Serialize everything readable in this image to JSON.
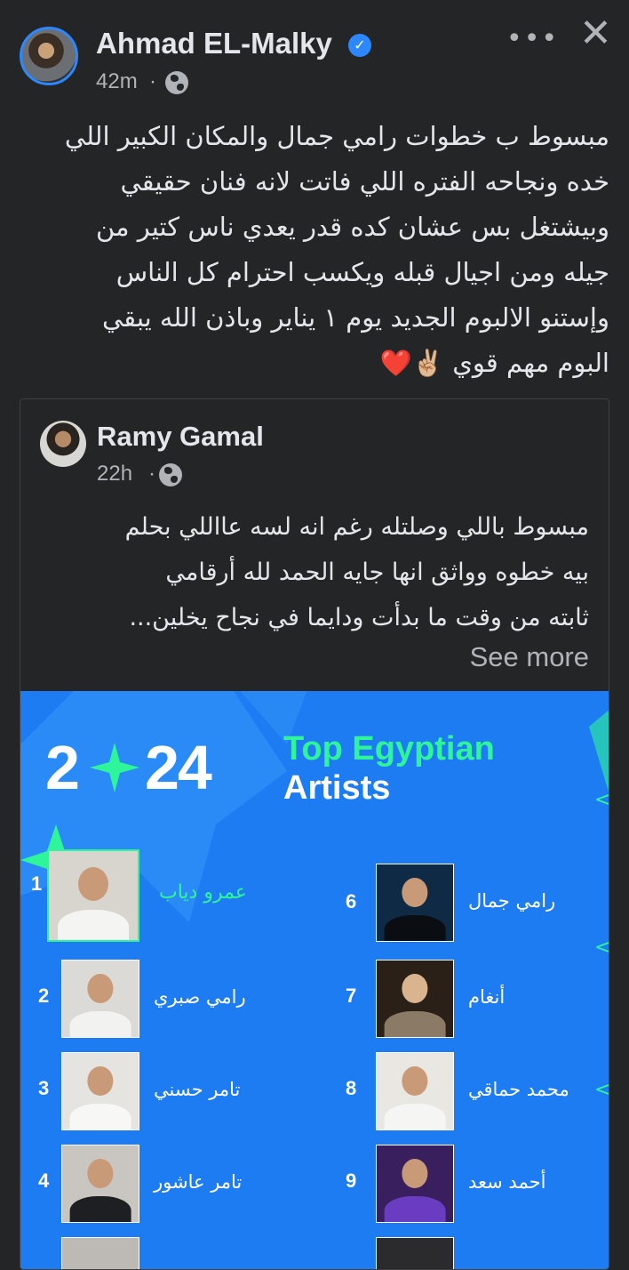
{
  "post": {
    "author": "Ahmad EL-Malky",
    "time": "42m",
    "privacy_icon": "globe-icon",
    "text_lines": [
      "مبسوط ب خطوات رامي جمال والمكان الكبير اللي",
      "خده ونجاحه الفتره اللي فاتت لانه فنان حقيقي",
      "وبيشتغل بس  عشان كده قدر يعدي ناس كتير من",
      "جيله ومن اجيال قبله ويكسب احترام كل الناس",
      "وإستنو الالبوم الجديد يوم ١ يناير   وباذن الله يبقي",
      "البوم مهم قوي ✌🏼❤️"
    ]
  },
  "shared": {
    "author": "Ramy Gamal",
    "time": "22h",
    "text_lines": [
      "مبسوط باللي وصلتله رغم انه لسه عااللي بحلم",
      "بيه خطوه وواثق انها جايه الحمد لله أرقامي",
      "ثابته من وقت ما بدأت ودايما في نجاح  يخلين..."
    ],
    "see_more": "See more"
  },
  "banner": {
    "year_left": "2",
    "year_right": "24",
    "title_line1": "Top Egyptian",
    "title_line2": "Artists",
    "accent_color": "#2ff59a",
    "background_color": "#1d7cf2",
    "artists": [
      {
        "rank": "1",
        "name": "عمرو دياب"
      },
      {
        "rank": "2",
        "name": "رامي صبري"
      },
      {
        "rank": "3",
        "name": "تامر حسني"
      },
      {
        "rank": "4",
        "name": "تامر عاشور"
      },
      {
        "rank": "6",
        "name": "رامي جمال"
      },
      {
        "rank": "7",
        "name": "أنغام"
      },
      {
        "rank": "8",
        "name": "محمد حماقي"
      },
      {
        "rank": "9",
        "name": "أحمد سعد"
      }
    ]
  },
  "icons": {
    "more": "•••",
    "close": "✕",
    "verified": "✓"
  }
}
